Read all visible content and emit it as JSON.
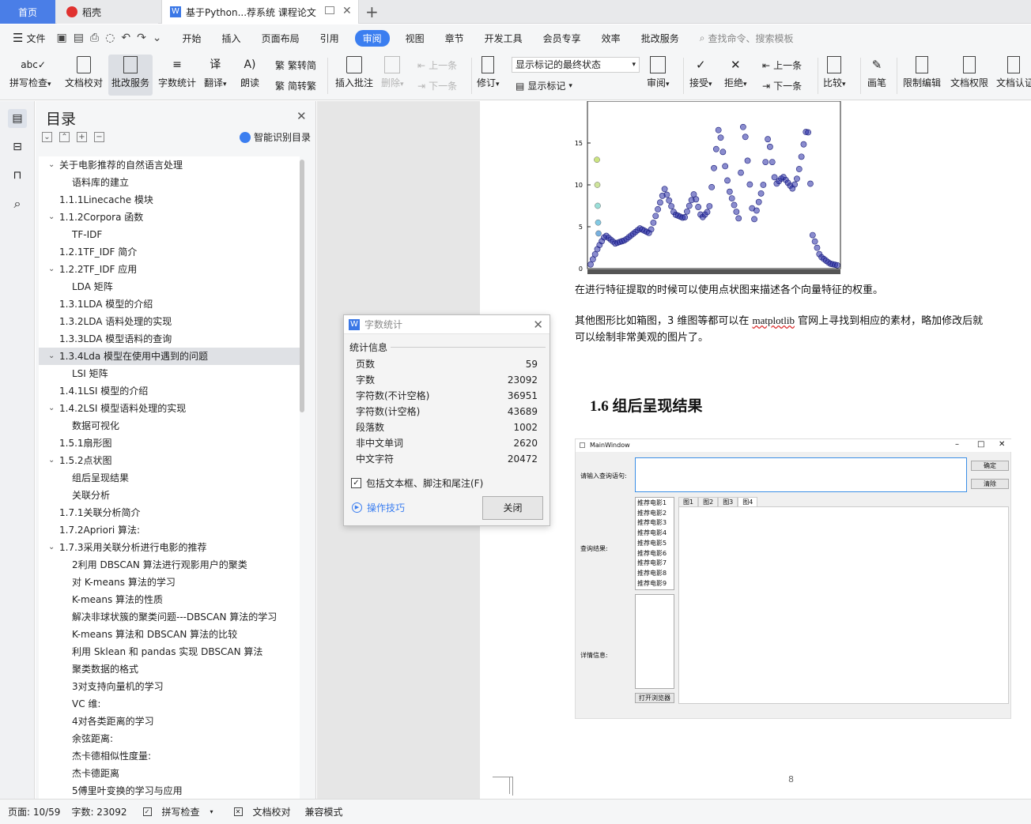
{
  "tabs": {
    "home": "首页",
    "daoke": "稻壳",
    "doc": "基于Python...荐系统 课程论文"
  },
  "menu": {
    "file": "文件",
    "items": [
      "开始",
      "插入",
      "页面布局",
      "引用",
      "审阅",
      "视图",
      "章节",
      "开发工具",
      "会员专享",
      "效率",
      "批改服务"
    ],
    "search_placeholder": "查找命令、搜索模板"
  },
  "ribbon": {
    "spell": "拼写检查",
    "proof": "文档校对",
    "correct": "批改服务",
    "wordcount": "字数统计",
    "translate": "翻译",
    "read": "朗读",
    "trad": "繁转简",
    "simp": "简转繁",
    "insert_comment": "插入批注",
    "delete": "删除",
    "prev": "上一条",
    "next": "下一条",
    "track": "修订",
    "markup_select": "显示标记的最终状态",
    "show_markup": "显示标记",
    "review": "审阅",
    "accept": "接受",
    "reject": "拒绝",
    "prev2": "上一条",
    "next2": "下一条",
    "compare": "比较",
    "pen": "画笔",
    "restrict": "限制编辑",
    "rights": "文档权限",
    "certify": "文档认证"
  },
  "toc": {
    "title": "目录",
    "smart": "智能识别目录",
    "items": [
      {
        "t": "关于电影推荐的自然语言处理",
        "l": 0,
        "c": true
      },
      {
        "t": "语料库的建立",
        "l": 2
      },
      {
        "t": "1.1.1Linecache 模块",
        "l": 1
      },
      {
        "t": "1.1.2Corpora 函数",
        "l": 0,
        "c": true
      },
      {
        "t": "TF-IDF",
        "l": 2
      },
      {
        "t": "1.2.1TF_IDF 简介",
        "l": 1
      },
      {
        "t": "1.2.2TF_IDF 应用",
        "l": 0,
        "c": true
      },
      {
        "t": "LDA 矩阵",
        "l": 2
      },
      {
        "t": "1.3.1LDA 模型的介绍",
        "l": 1
      },
      {
        "t": "1.3.2LDA 语料处理的实现",
        "l": 1
      },
      {
        "t": "1.3.3LDA 模型语料的查询",
        "l": 1
      },
      {
        "t": "1.3.4Lda 模型在使用中遇到的问题",
        "l": 0,
        "c": true,
        "sel": true
      },
      {
        "t": "LSI 矩阵",
        "l": 2
      },
      {
        "t": "1.4.1LSI 模型的介绍",
        "l": 1
      },
      {
        "t": "1.4.2LSI 模型语料处理的实现",
        "l": 0,
        "c": true
      },
      {
        "t": "数据可视化",
        "l": 2
      },
      {
        "t": "1.5.1扇形图",
        "l": 1
      },
      {
        "t": "1.5.2点状图",
        "l": 0,
        "c": true
      },
      {
        "t": "组后呈现结果",
        "l": 2
      },
      {
        "t": "关联分析",
        "l": 2
      },
      {
        "t": "1.7.1关联分析简介",
        "l": 1
      },
      {
        "t": "1.7.2Apriori 算法:",
        "l": 1
      },
      {
        "t": "1.7.3采用关联分析进行电影的推荐",
        "l": 0,
        "c": true
      },
      {
        "t": "2利用 DBSCAN 算法进行观影用户的聚类",
        "l": 2
      },
      {
        "t": "对 K-means 算法的学习",
        "l": 2
      },
      {
        "t": "K-means 算法的性质",
        "l": 2
      },
      {
        "t": "解决非球状簇的聚类问题---DBSCAN 算法的学习",
        "l": 2
      },
      {
        "t": "K-means 算法和 DBSCAN 算法的比较",
        "l": 2
      },
      {
        "t": "利用 Sklean 和 pandas 实现 DBSCAN 算法",
        "l": 2
      },
      {
        "t": "聚类数据的格式",
        "l": 2
      },
      {
        "t": "3对支持向量机的学习",
        "l": 2
      },
      {
        "t": "VC 维:",
        "l": 2
      },
      {
        "t": "4对各类距离的学习",
        "l": 2
      },
      {
        "t": "余弦距离:",
        "l": 2
      },
      {
        "t": "杰卡德相似性度量:",
        "l": 2
      },
      {
        "t": "杰卡德距离",
        "l": 2
      },
      {
        "t": "5傅里叶变换的学习与应用",
        "l": 2
      }
    ]
  },
  "doc": {
    "yticks": [
      "15",
      "10",
      "5",
      "0"
    ],
    "para1": "在进行特征提取的时候可以使用点状图来描述各个向量特征的权重。",
    "para2a": "其他图形比如箱图，3 维图等都可以在 ",
    "para2b": "matplotlib",
    "para2c": " 官网上寻找到相应的素材，略加修改后就",
    "para2d": "可以绘制非常美观的图片了。",
    "heading": "1.6  组后呈现结果",
    "page_num": "8",
    "win": {
      "title": "MainWindow",
      "query_label": "请输入查询语句:",
      "ok": "确定",
      "clear": "清除",
      "result_label": "查询结果:",
      "list": [
        "推荐电影1",
        "推荐电影2",
        "推荐电影3",
        "推荐电影4",
        "推荐电影5",
        "推荐电影6",
        "推荐电影7",
        "推荐电影8",
        "推荐电影9"
      ],
      "tabs": [
        "图1",
        "图2",
        "图3",
        "图4"
      ],
      "detail_label": "详情信息:",
      "browser": "打开浏览器"
    }
  },
  "dialog": {
    "title": "字数统计",
    "group": "统计信息",
    "rows": [
      {
        "k": "页数",
        "v": "59"
      },
      {
        "k": "字数",
        "v": "23092"
      },
      {
        "k": "字符数(不计空格)",
        "v": "36951"
      },
      {
        "k": "字符数(计空格)",
        "v": "43689"
      },
      {
        "k": "段落数",
        "v": "1002"
      },
      {
        "k": "非中文单词",
        "v": "2620"
      },
      {
        "k": "中文字符",
        "v": "20472"
      }
    ],
    "include": "包括文本框、脚注和尾注(F)",
    "tips": "操作技巧",
    "close": "关闭"
  },
  "status": {
    "page": "页面: 10/59",
    "words": "字数: 23092",
    "spell": "拼写检查",
    "proof": "文档校对",
    "compat": "兼容模式"
  }
}
